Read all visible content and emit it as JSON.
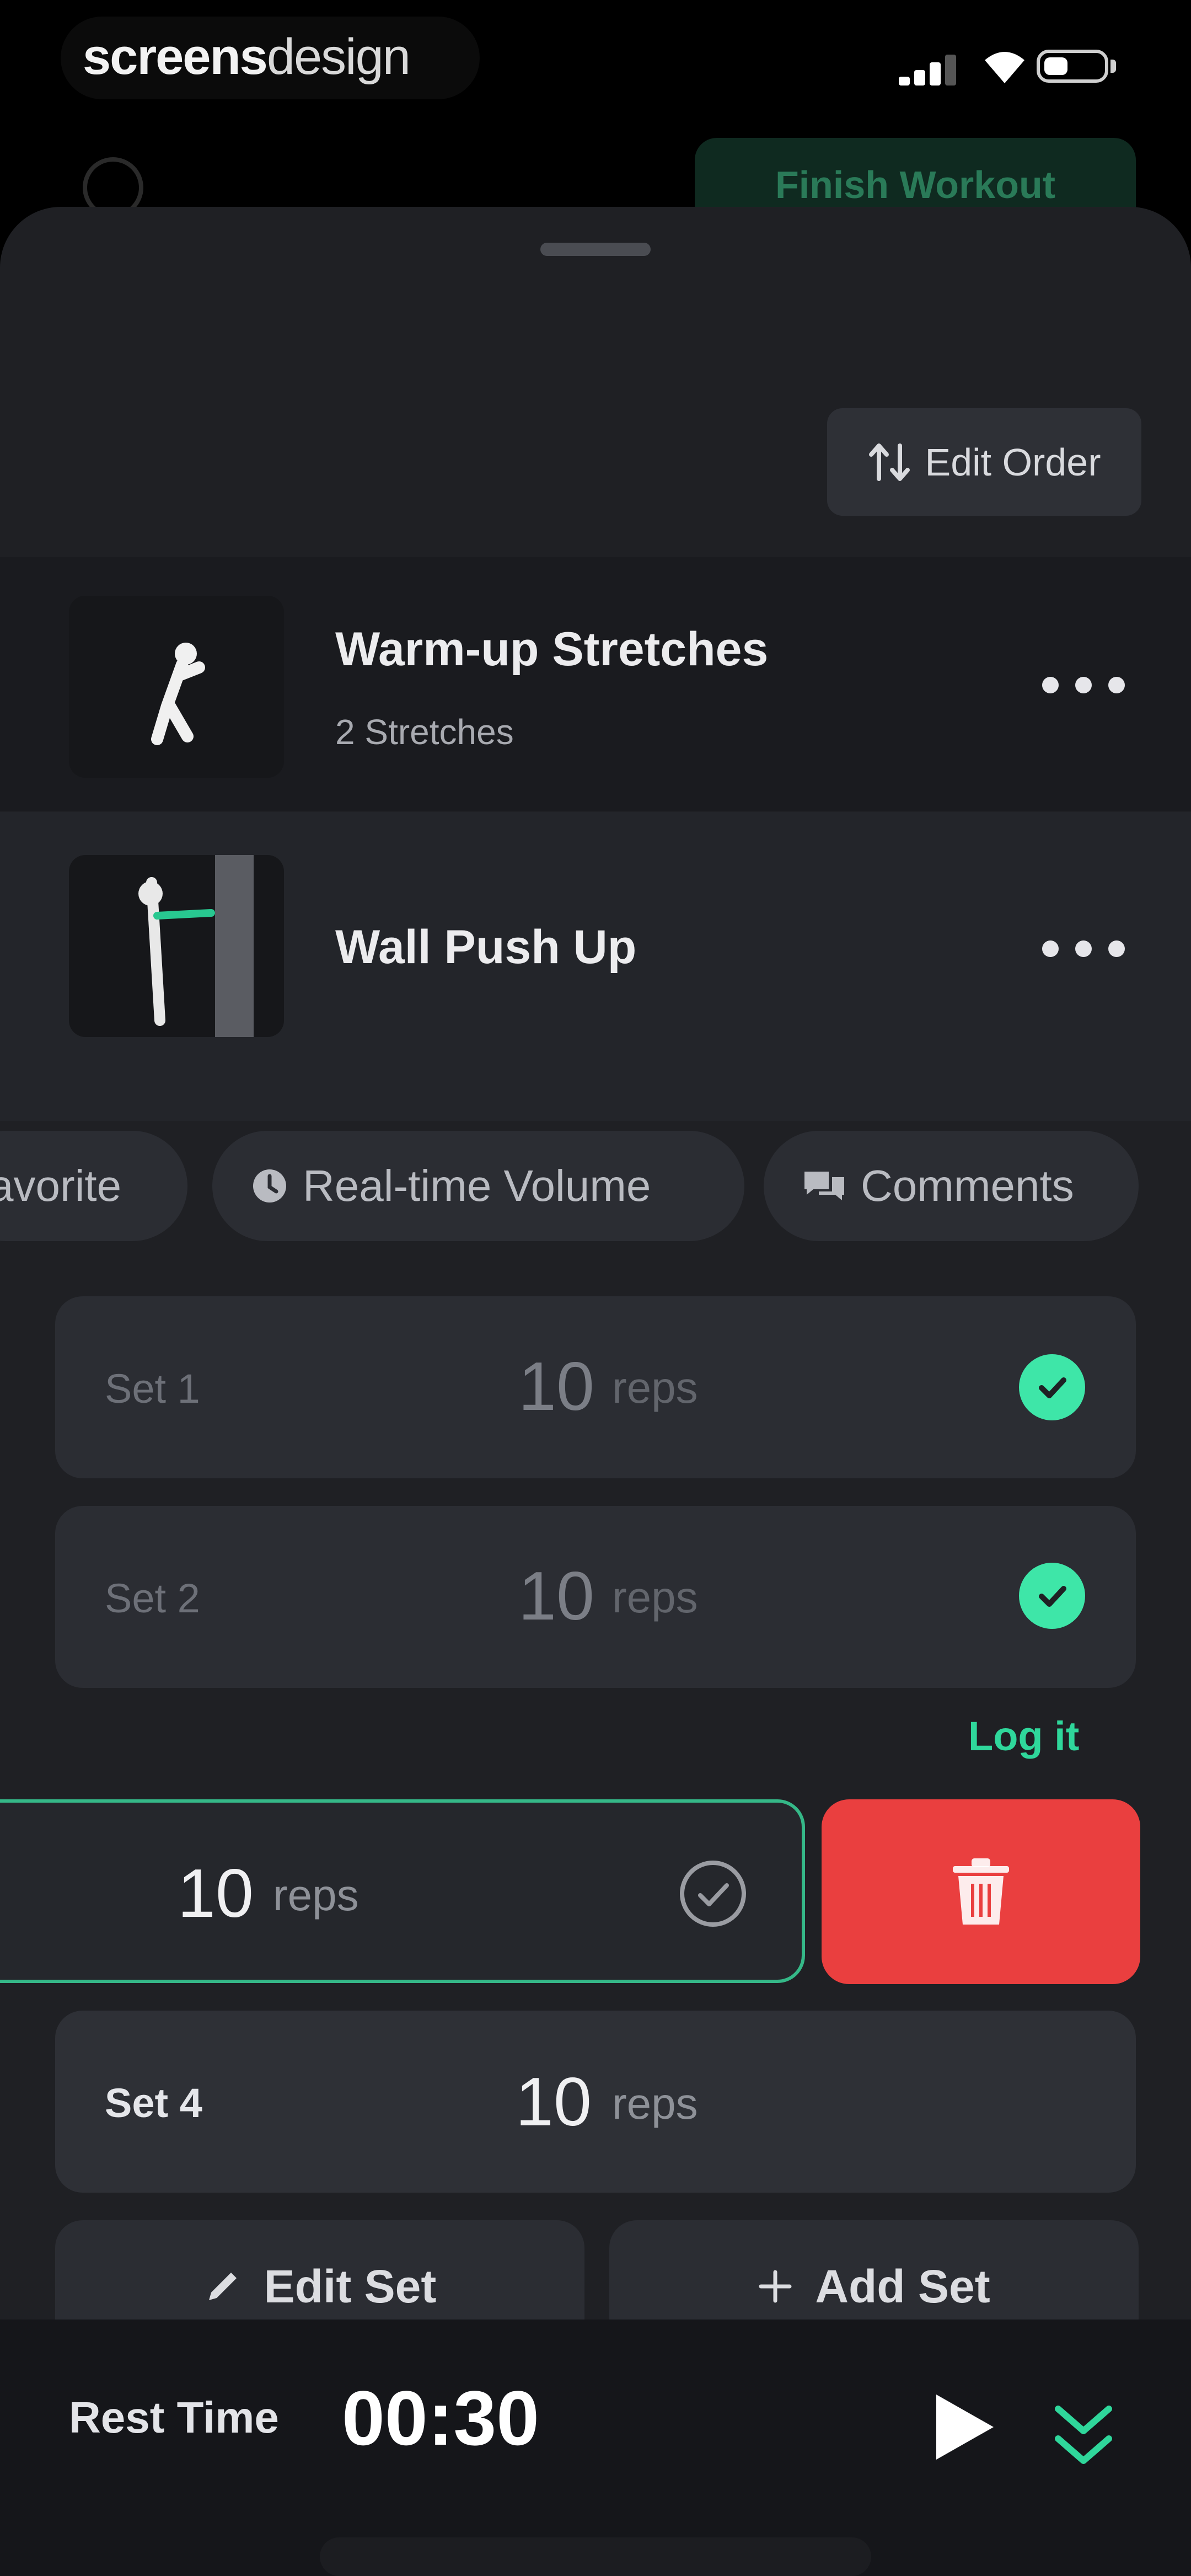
{
  "status_bar": {
    "brand_bold": "screens",
    "brand_light": "design",
    "icons": [
      "signal-icon",
      "wifi-icon",
      "battery-icon"
    ]
  },
  "background": {
    "finish_label": "Finish Workout"
  },
  "toolbar": {
    "edit_order_label": "Edit Order"
  },
  "exercises": [
    {
      "title": "Warm-up Stretches",
      "subtitle": "2 Stretches"
    },
    {
      "title": "Wall Push Up",
      "subtitle": ""
    }
  ],
  "chips": [
    {
      "label": "avorite",
      "icon": "heart-icon"
    },
    {
      "label": "Real-time Volume",
      "icon": "clock-icon"
    },
    {
      "label": "Comments",
      "icon": "comments-icon"
    }
  ],
  "sets": [
    {
      "label": "Set 1",
      "value": "10",
      "unit": "reps",
      "completed": true
    },
    {
      "label": "Set 2",
      "value": "10",
      "unit": "reps",
      "completed": true
    },
    {
      "label": "",
      "value": "10",
      "unit": "reps",
      "completed": false
    },
    {
      "label": "Set 4",
      "value": "10",
      "unit": "reps",
      "completed": false
    }
  ],
  "log_it_label": "Log it",
  "actions": {
    "edit_set_label": "Edit Set",
    "add_set_label": "Add Set"
  },
  "rest": {
    "label": "Rest Time",
    "time": "00:30"
  },
  "colors": {
    "accent_green": "#3ee6a8",
    "delete_red": "#ea3f3f",
    "sheet_bg": "#1f2024",
    "card_bg": "#2b2d33"
  }
}
